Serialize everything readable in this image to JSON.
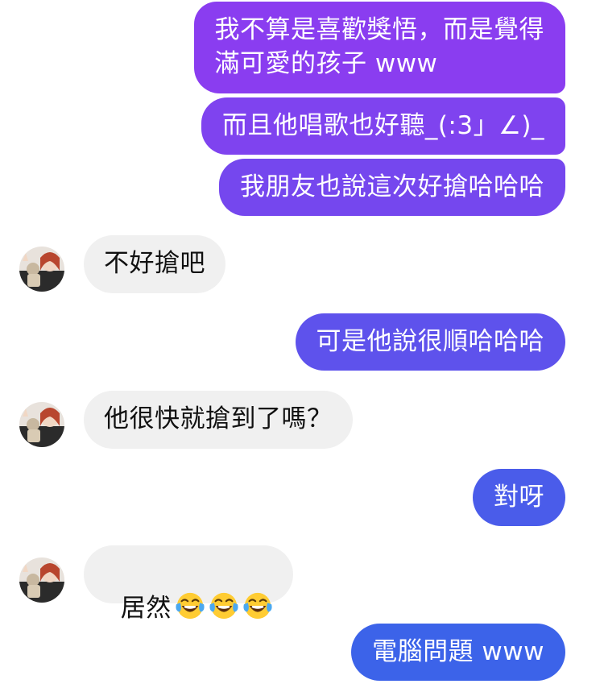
{
  "messages": [
    {
      "from": "me",
      "text": "我不算是喜歡獎悟，而是覺得\n滿可愛的孩子 www",
      "color": "#8a3df0"
    },
    {
      "from": "me",
      "text": "而且他唱歌也好聽_(:3」∠)_",
      "color": "#7f43ef"
    },
    {
      "from": "me",
      "text": "我朋友也說這次好搶哈哈哈",
      "color": "#7547ee"
    },
    {
      "from": "them",
      "text": "不好搶吧"
    },
    {
      "from": "me",
      "text": "可是他說很順哈哈哈",
      "color": "#5e52ec"
    },
    {
      "from": "them",
      "text": "他很快就搶到了嗎？"
    },
    {
      "from": "me",
      "text": "對呀",
      "color": "#4a5cea"
    },
    {
      "from": "them",
      "text": "居然",
      "emoji": [
        "face-with-tears-of-joy",
        "face-with-tears-of-joy",
        "face-with-tears-of-joy"
      ]
    },
    {
      "from": "me",
      "text": "電腦問題 www",
      "color": "#3c63e9"
    }
  ],
  "contact": {
    "avatar": "contact-avatar-photo"
  }
}
